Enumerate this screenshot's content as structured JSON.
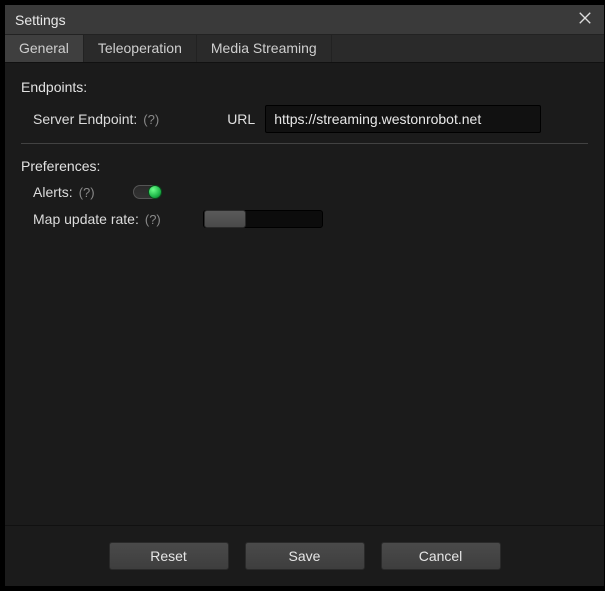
{
  "window": {
    "title": "Settings"
  },
  "tabs": [
    {
      "label": "General",
      "active": true
    },
    {
      "label": "Teleoperation",
      "active": false
    },
    {
      "label": "Media Streaming",
      "active": false
    }
  ],
  "sections": {
    "endpoints": {
      "title": "Endpoints:",
      "server_label": "Server Endpoint:",
      "server_help": "(?)",
      "url_label": "URL",
      "url_value": "https://streaming.westonrobot.net"
    },
    "preferences": {
      "title": "Preferences:",
      "alerts_label": "Alerts:",
      "alerts_help": "(?)",
      "alerts_on": true,
      "map_rate_label": "Map update rate:",
      "map_rate_help": "(?)",
      "map_rate_value": 0.2
    }
  },
  "buttons": {
    "reset": "Reset",
    "save": "Save",
    "cancel": "Cancel"
  }
}
